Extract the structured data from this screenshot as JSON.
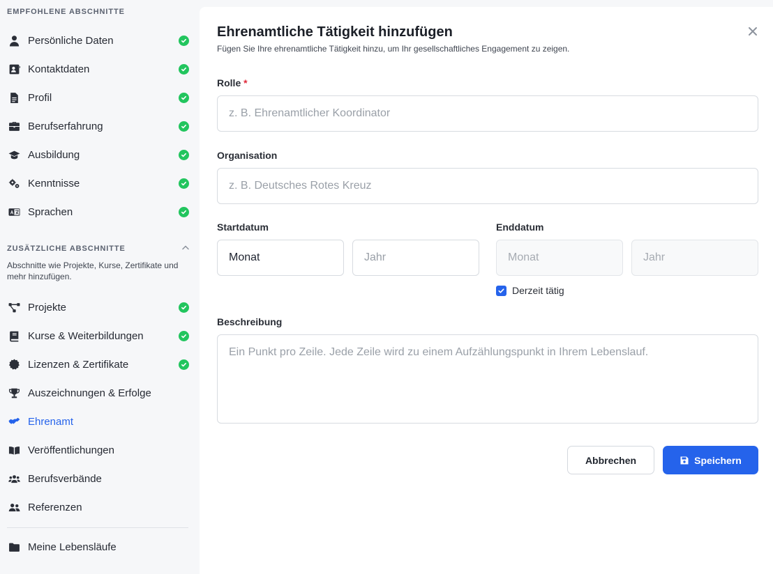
{
  "sidebar": {
    "recommended_title": "EMPFOHLENE ABSCHNITTE",
    "recommended": [
      {
        "label": "Persönliche Daten",
        "icon": "user-icon",
        "done": true
      },
      {
        "label": "Kontaktdaten",
        "icon": "contact-card-icon",
        "done": true
      },
      {
        "label": "Profil",
        "icon": "document-icon",
        "done": true
      },
      {
        "label": "Berufserfahrung",
        "icon": "briefcase-icon",
        "done": true
      },
      {
        "label": "Ausbildung",
        "icon": "graduation-cap-icon",
        "done": true
      },
      {
        "label": "Kenntnisse",
        "icon": "gears-icon",
        "done": true
      },
      {
        "label": "Sprachen",
        "icon": "language-icon",
        "done": true
      }
    ],
    "additional_title": "ZUSÄTZLICHE ABSCHNITTE",
    "additional_desc": "Abschnitte wie Projekte, Kurse, Zertifikate und mehr hinzufügen.",
    "additional": [
      {
        "label": "Projekte",
        "icon": "project-diagram-icon",
        "done": true
      },
      {
        "label": "Kurse & Weiterbildungen",
        "icon": "book-icon",
        "done": true
      },
      {
        "label": "Lizenzen & Zertifikate",
        "icon": "certificate-icon",
        "done": true
      },
      {
        "label": "Auszeichnungen & Erfolge",
        "icon": "trophy-icon",
        "done": false
      },
      {
        "label": "Ehrenamt",
        "icon": "handshake-icon",
        "done": false,
        "active": true
      },
      {
        "label": "Veröffentlichungen",
        "icon": "open-book-icon",
        "done": false
      },
      {
        "label": "Berufsverbände",
        "icon": "users-icon",
        "done": false
      },
      {
        "label": "Referenzen",
        "icon": "user-friends-icon",
        "done": false
      }
    ],
    "footer_item": {
      "label": "Meine Lebensläufe",
      "icon": "folder-icon"
    }
  },
  "dialog": {
    "title": "Ehrenamtliche Tätigkeit hinzufügen",
    "subtitle": "Fügen Sie Ihre ehrenamtliche Tätigkeit hinzu, um Ihr gesellschaftliches Engagement zu zeigen.",
    "role_label": "Rolle",
    "required_mark": "*",
    "role_placeholder": "z. B. Ehrenamtlicher Koordinator",
    "org_label": "Organisation",
    "org_placeholder": "z. B. Deutsches Rotes Kreuz",
    "start_label": "Startdatum",
    "start_month_value": "Monat",
    "start_year_placeholder": "Jahr",
    "end_label": "Enddatum",
    "end_month_placeholder": "Monat",
    "end_year_placeholder": "Jahr",
    "current_label": "Derzeit tätig",
    "current_checked": true,
    "desc_label": "Beschreibung",
    "desc_placeholder": "Ein Punkt pro Zeile. Jede Zeile wird zu einem Aufzählungspunkt in Ihrem Lebenslauf.",
    "cancel_label": "Abbrechen",
    "save_label": "Speichern"
  },
  "colors": {
    "accent": "#2563eb",
    "success": "#22c55e",
    "required": "#e0293a"
  }
}
